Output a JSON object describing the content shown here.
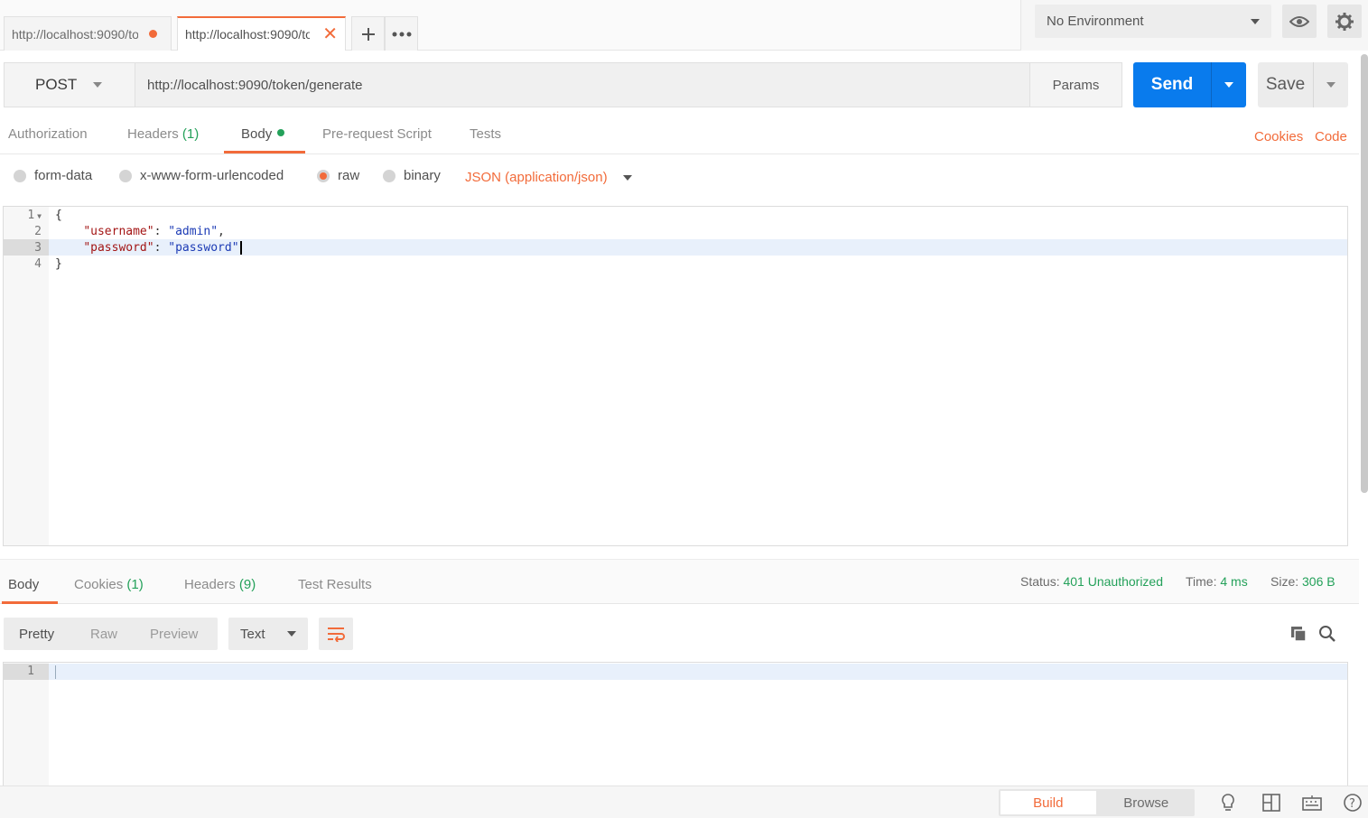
{
  "tabs": [
    {
      "title": "http://localhost:9090/token/generate",
      "unsaved": true
    },
    {
      "title": "http://localhost:9090/token/generate",
      "active": true
    }
  ],
  "environment": {
    "selected": "No Environment"
  },
  "request": {
    "method": "POST",
    "url": "http://localhost:9090/token/generate",
    "params_label": "Params",
    "send_label": "Send",
    "save_label": "Save"
  },
  "request_tabs": {
    "authorization": "Authorization",
    "headers": "Headers",
    "headers_count": "(1)",
    "body": "Body",
    "prerequest": "Pre-request Script",
    "tests": "Tests",
    "cookies_link": "Cookies",
    "code_link": "Code"
  },
  "body_types": {
    "form_data": "form-data",
    "urlencoded": "x-www-form-urlencoded",
    "raw": "raw",
    "binary": "binary",
    "content_type": "JSON (application/json)",
    "selected": "raw"
  },
  "request_body_lines": [
    {
      "n": "1",
      "text": "{"
    },
    {
      "n": "2",
      "key": "\"username\"",
      "value": "\"admin\""
    },
    {
      "n": "3",
      "key": "\"password\"",
      "value": "\"password\""
    },
    {
      "n": "4",
      "text": "}"
    }
  ],
  "response_tabs": {
    "body": "Body",
    "cookies": "Cookies",
    "cookies_count": "(1)",
    "headers": "Headers",
    "headers_count": "(9)",
    "test_results": "Test Results"
  },
  "response_status": {
    "status_label": "Status:",
    "status_value": "401 Unauthorized",
    "time_label": "Time:",
    "time_value": "4 ms",
    "size_label": "Size:",
    "size_value": "306 B"
  },
  "response_view": {
    "pretty": "Pretty",
    "raw": "Raw",
    "preview": "Preview",
    "format": "Text",
    "line": "1"
  },
  "footer": {
    "build": "Build",
    "browse": "Browse"
  },
  "colors": {
    "accent": "#f26b3a",
    "send": "#097bed",
    "success": "#24a15a"
  }
}
